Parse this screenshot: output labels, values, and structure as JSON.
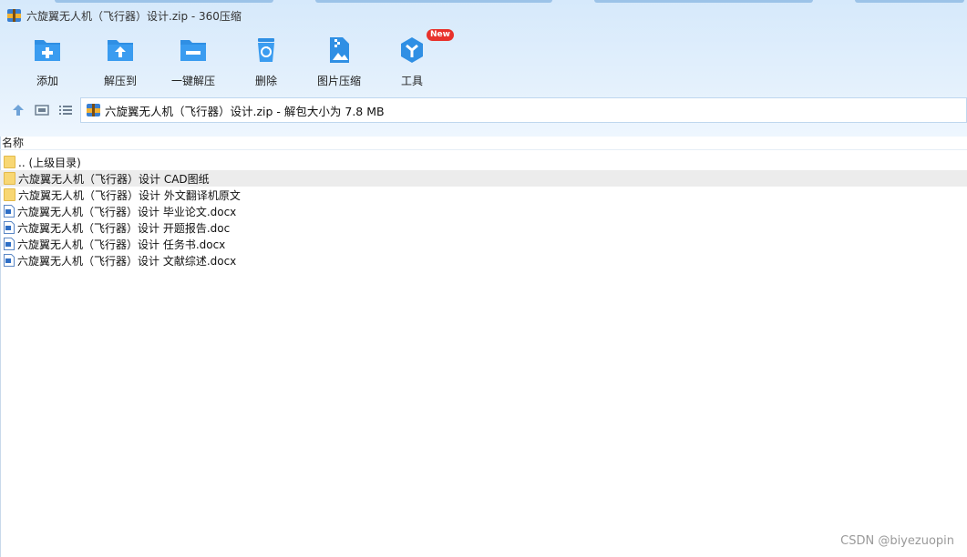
{
  "window": {
    "title": "六旋翼无人机（飞行器）设计.zip - 360压缩"
  },
  "toolbar": {
    "items": [
      {
        "label": "添加",
        "icon": "add-icon"
      },
      {
        "label": "解压到",
        "icon": "extract-to-icon"
      },
      {
        "label": "一键解压",
        "icon": "one-click-extract-icon"
      },
      {
        "label": "删除",
        "icon": "delete-icon"
      },
      {
        "label": "图片压缩",
        "icon": "image-compress-icon"
      },
      {
        "label": "工具",
        "icon": "tools-icon",
        "badge": "New"
      }
    ]
  },
  "address": {
    "path_text": "六旋翼无人机（飞行器）设计.zip - 解包大小为 7.8 MB"
  },
  "list": {
    "column_name": "名称",
    "rows": [
      {
        "name": ".. (上级目录)",
        "type": "folder"
      },
      {
        "name": "六旋翼无人机（飞行器）设计 CAD图纸",
        "type": "folder"
      },
      {
        "name": "六旋翼无人机（飞行器）设计 外文翻译机原文",
        "type": "folder"
      },
      {
        "name": "六旋翼无人机（飞行器）设计 毕业论文.docx",
        "type": "doc"
      },
      {
        "name": "六旋翼无人机（飞行器）设计 开题报告.doc",
        "type": "doc"
      },
      {
        "name": "六旋翼无人机（飞行器）设计 任务书.docx",
        "type": "doc"
      },
      {
        "name": "六旋翼无人机（飞行器）设计 文献综述.docx",
        "type": "doc"
      }
    ]
  },
  "watermark": "CSDN @biyezuopin",
  "colors": {
    "accent": "#2f8fe4",
    "toolbar_bg": "#e3f0fc",
    "badge": "#e8312c",
    "folder": "#f8d774"
  }
}
